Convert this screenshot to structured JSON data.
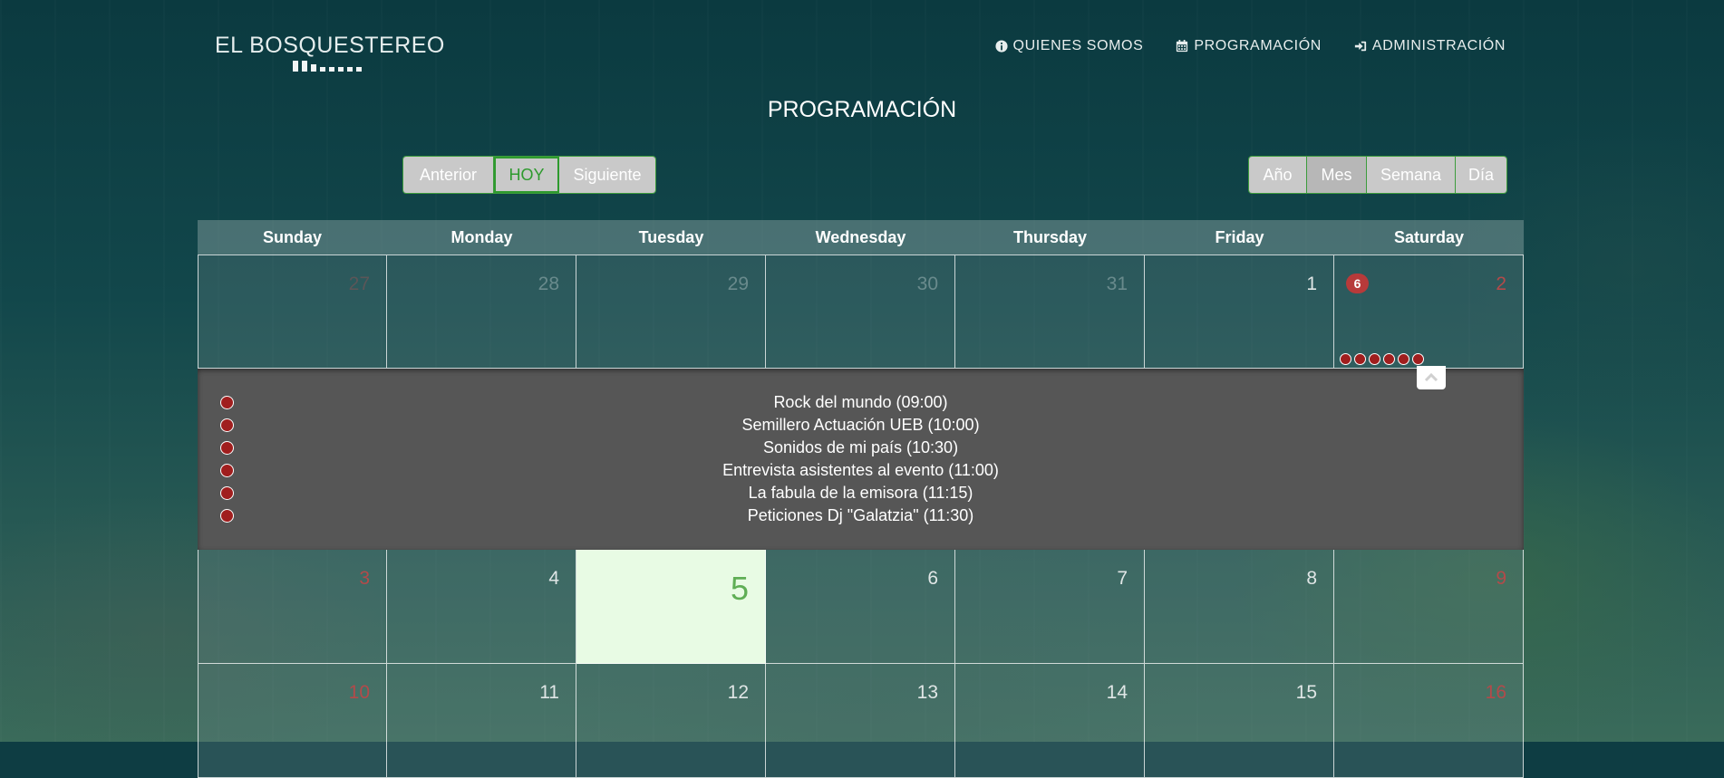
{
  "brand": {
    "name": "EL BOSQUESTEREO"
  },
  "nav": [
    {
      "label": "QUIENES SOMOS",
      "icon": "info-circle-icon"
    },
    {
      "label": "PROGRAMACIÓN",
      "icon": "calendar-icon"
    },
    {
      "label": "ADMINISTRACIÓN",
      "icon": "sign-in-icon"
    }
  ],
  "page_title": "PROGRAMACIÓN",
  "navigation_buttons": {
    "prev": "Anterior",
    "today": "HOY",
    "next": "Siguiente"
  },
  "view_buttons": {
    "year": "Año",
    "month": "Mes",
    "week": "Semana",
    "day": "Día",
    "active": "Mes"
  },
  "calendar": {
    "weekdays": [
      "Sunday",
      "Monday",
      "Tuesday",
      "Wednesday",
      "Thursday",
      "Friday",
      "Saturday"
    ],
    "weeks": [
      [
        "27",
        "28",
        "29",
        "30",
        "31",
        "1",
        "2"
      ],
      [
        "3",
        "4",
        "5",
        "6",
        "7",
        "8",
        "9"
      ],
      [
        "10",
        "11",
        "12",
        "13",
        "14",
        "15",
        "16"
      ]
    ],
    "today": "5",
    "event_count_badge": "6",
    "selected_day": "2"
  },
  "events": [
    {
      "title": "Rock del mundo (09:00)"
    },
    {
      "title": "Semillero Actuación UEB (10:00)"
    },
    {
      "title": "Sonidos de mi país (10:30)"
    },
    {
      "title": "Entrevista asistentes al evento (11:00)"
    },
    {
      "title": "La fabula de la emisora (11:15)"
    },
    {
      "title": "Peticiones Dj \"Galatzia\" (11:30)"
    }
  ],
  "colors": {
    "event_dot": "#a01e1e",
    "badge": "#b73a3a",
    "today_bg": "#e8fbe4",
    "accent_green": "#2e9a2e"
  }
}
